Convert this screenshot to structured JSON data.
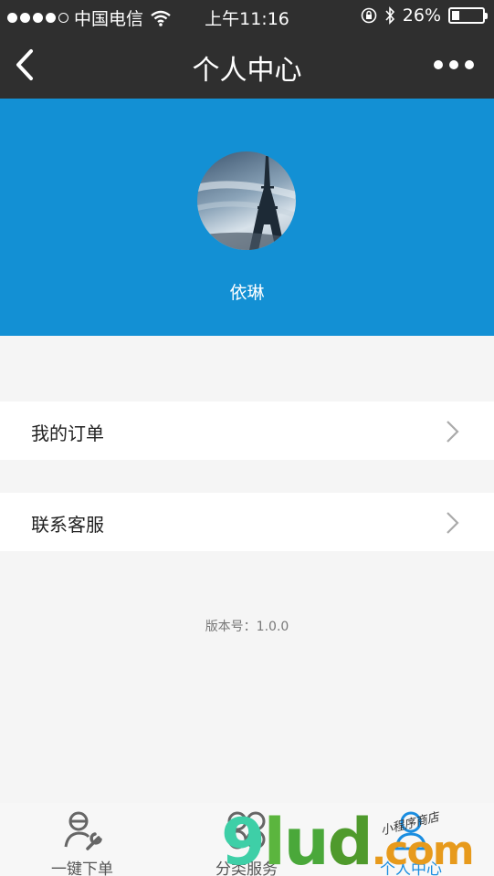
{
  "status_bar": {
    "carrier": "中国电信",
    "time": "上午11:16",
    "battery_percent_text": "26%",
    "battery_level": 0.26
  },
  "nav": {
    "title": "个人中心",
    "back_icon": "chevron-left-icon",
    "more_icon": "more-horizontal-icon"
  },
  "profile": {
    "username": "依琳",
    "avatar_subject": "eiffel-tower-photo"
  },
  "menu": [
    {
      "label": "我的订单",
      "icon": "chevron-right-icon"
    },
    {
      "label": "联系客服",
      "icon": "chevron-right-icon"
    }
  ],
  "version_text": "版本号：1.0.0",
  "tabbar": [
    {
      "label": "一键下单",
      "icon": "wrench-person-icon",
      "active": false
    },
    {
      "label": "分类服务",
      "icon": "category-grid-icon",
      "active": false
    },
    {
      "label": "个人中心",
      "icon": "person-icon",
      "active": true
    }
  ],
  "watermark": {
    "text_main": "9lud",
    "text_suffix": ".com",
    "text_small": "小程序商店"
  },
  "colors": {
    "header_bg": "#2f2f2f",
    "profile_bg": "#1390d4",
    "page_bg": "#f5f5f5",
    "active_tab": "#1a8de0"
  }
}
